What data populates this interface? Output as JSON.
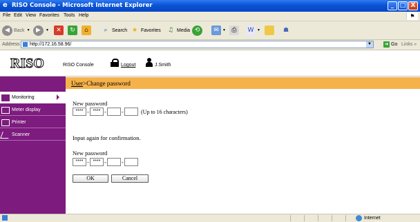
{
  "window": {
    "title": "RISO Console - Microsoft Internet Explorer",
    "buttons": {
      "minimize": "_",
      "maximize": "□",
      "close": "X"
    }
  },
  "menu": [
    "File",
    "Edit",
    "View",
    "Favorites",
    "Tools",
    "Help"
  ],
  "toolbar": {
    "back": "Back",
    "search": "Search",
    "favorites": "Favorites",
    "media": "Media"
  },
  "address": {
    "label": "Address",
    "url": "http://172.16.58.96/",
    "go": "Go",
    "links": "Links"
  },
  "header": {
    "logo": "RISO",
    "console_title": "RISO Console",
    "logout": "Logout",
    "user": "J.Smith"
  },
  "sidebar": {
    "items": [
      {
        "label": "Monitoring",
        "active": true
      },
      {
        "label": "Meter display",
        "active": false
      },
      {
        "label": "Printer",
        "active": false
      },
      {
        "label": "Scanner",
        "active": false
      }
    ]
  },
  "breadcrumb": {
    "link": "User",
    "separator": ">",
    "current": "Change password"
  },
  "form": {
    "new_password_label": "New password",
    "password_fields": [
      "****",
      "****",
      "",
      ""
    ],
    "hint": "(Up to 16 characters)",
    "confirm_instruction": "Input again for confirmation.",
    "confirm_label": "New password",
    "confirm_fields": [
      "****",
      "****",
      "",
      ""
    ],
    "ok": "OK",
    "cancel": "Cancel"
  },
  "status": {
    "zone": "Internet"
  },
  "colors": {
    "sidebar": "#7d1b7e",
    "breadcrumb_bar": "#f6b24a",
    "titlebar": "#0a53d6"
  }
}
